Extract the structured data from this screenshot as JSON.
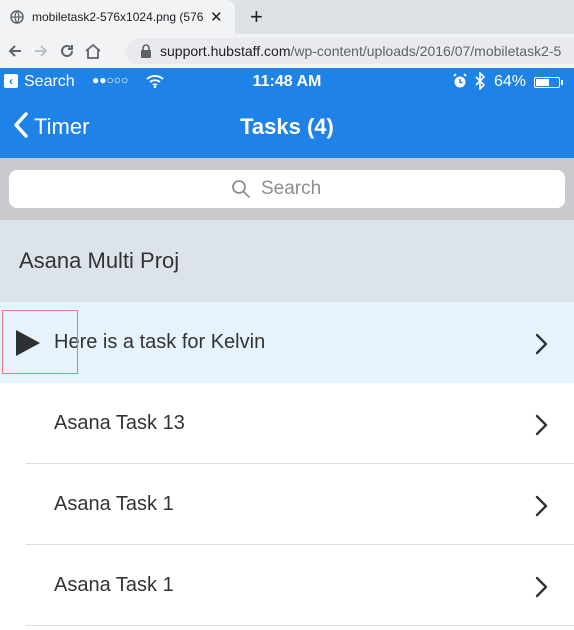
{
  "browser": {
    "tab_title": "mobiletask2-576x1024.png (576×",
    "new_tab": "+",
    "close": "✕",
    "url_host": "support.hubstaff.com",
    "url_path": "/wp-content/uploads/2016/07/mobiletask2-5"
  },
  "statusbar": {
    "back_app": "Search",
    "signal": "●●○○○",
    "time": "11:48 AM",
    "battery": "64%",
    "battery_level": 0.64
  },
  "nav": {
    "back_label": "Timer",
    "title": "Tasks (4)"
  },
  "search": {
    "placeholder": "Search"
  },
  "section": {
    "title": "Asana Multi Proj"
  },
  "tasks": [
    {
      "label": "Here is a task for Kelvin"
    },
    {
      "label": "Asana Task 13"
    },
    {
      "label": "Asana Task 1"
    },
    {
      "label": "Asana Task 1"
    }
  ],
  "colors": {
    "brand_blue": "#1f82e6",
    "active_row": "#e6f2fc",
    "section_bg": "#dde3ea"
  }
}
